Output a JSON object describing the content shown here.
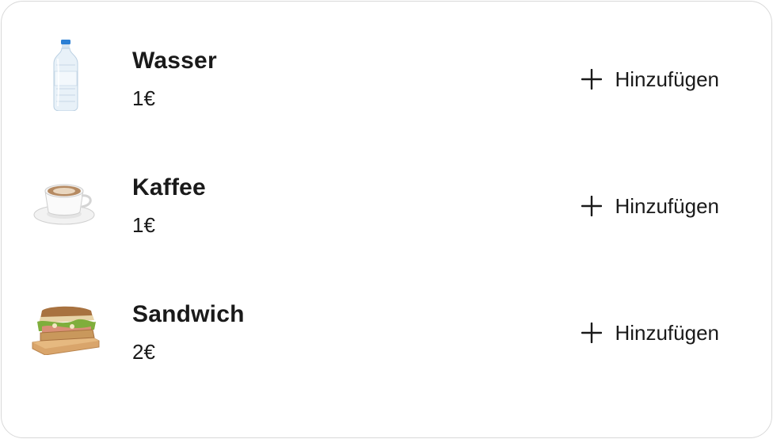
{
  "products": [
    {
      "name": "Wasser",
      "price": "1€",
      "image_icon": "water-bottle-icon",
      "add_label": "Hinzufügen"
    },
    {
      "name": "Kaffee",
      "price": "1€",
      "image_icon": "coffee-cup-icon",
      "add_label": "Hinzufügen"
    },
    {
      "name": "Sandwich",
      "price": "2€",
      "image_icon": "sandwich-icon",
      "add_label": "Hinzufügen"
    }
  ],
  "colors": {
    "text": "#1a1a1a",
    "border": "#d9d9d9",
    "background": "#ffffff"
  }
}
